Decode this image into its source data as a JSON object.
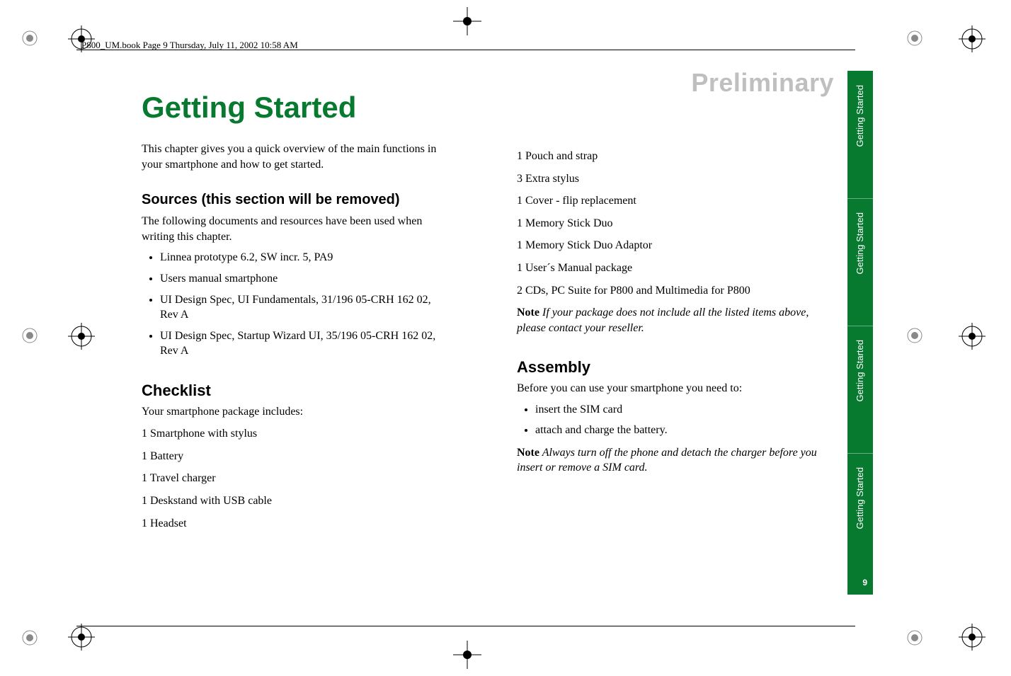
{
  "header": {
    "running_head": "P800_UM.book  Page 9  Thursday, July 11, 2002  10:58 AM",
    "watermark": "Preliminary"
  },
  "title": "Getting Started",
  "left": {
    "intro": "This chapter gives you a quick overview of the main functions in your smartphone and how to get started.",
    "sources_heading": "Sources (this section will be removed)",
    "sources_intro": "The following documents and resources have been used when writing this chapter.",
    "sources_bullets": [
      "Linnea prototype 6.2, SW incr. 5, PA9",
      "Users manual smartphone",
      "UI Design Spec, UI Fundamentals, 31/196 05-CRH 162 02, Rev A",
      "UI Design Spec, Startup Wizard UI, 35/196 05-CRH 162 02, Rev A"
    ],
    "checklist_heading": "Checklist",
    "checklist_intro": "Your smartphone package includes:",
    "checklist_items": [
      "1 Smartphone with stylus",
      "1 Battery",
      "1 Travel charger",
      "1 Deskstand with USB cable",
      "1 Headset"
    ]
  },
  "right": {
    "checklist_items": [
      "1 Pouch and strap",
      "3 Extra stylus",
      "1 Cover - flip replacement",
      "1 Memory Stick Duo",
      "1 Memory Stick Duo Adaptor",
      "1 User´s Manual package",
      "2 CDs, PC Suite for P800 and Multimedia for P800"
    ],
    "note1_label": "Note",
    "note1_text": " If your package does not include all the listed items above, please contact your reseller.",
    "assembly_heading": "Assembly",
    "assembly_intro": "Before you can use your smartphone you need to:",
    "assembly_bullets": [
      "insert the SIM card",
      "attach and charge the battery."
    ],
    "note2_label": "Note",
    "note2_text": " Always turn off the phone and detach the charger before you insert or remove a SIM card."
  },
  "sidebar": {
    "tab1": "Getting Started",
    "tab2": "Getting Started",
    "tab3": "Getting Started",
    "tab4": "Getting Started",
    "page": "9"
  }
}
